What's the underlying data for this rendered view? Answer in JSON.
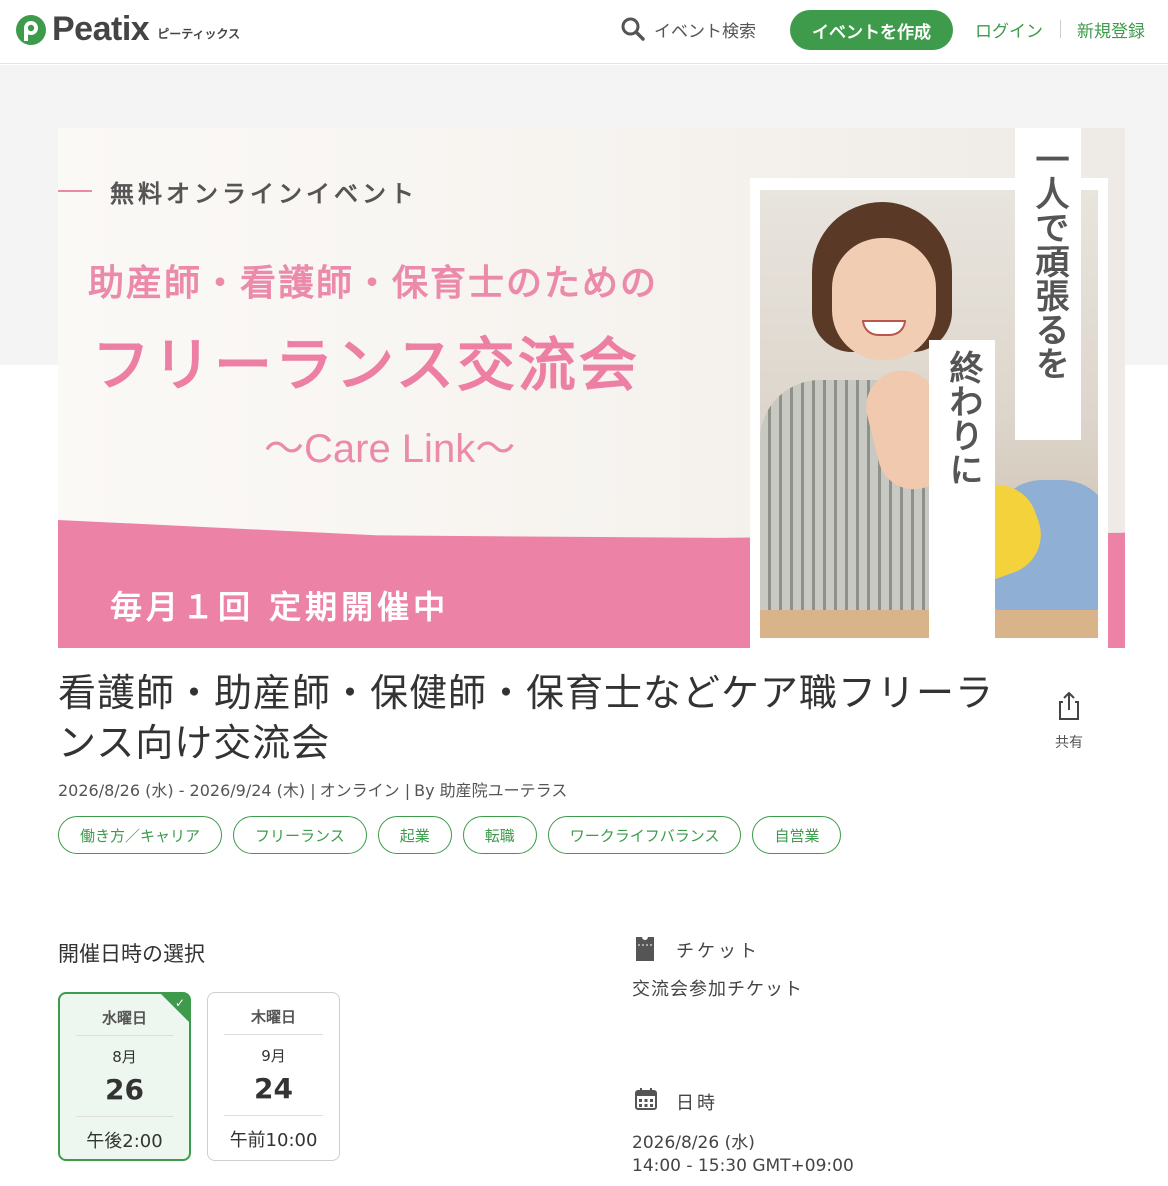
{
  "header": {
    "logo_text": "Peatix",
    "logo_sub": "ピーティックス",
    "search_label": "イベント検索",
    "create_label": "イベントを作成",
    "login_label": "ログイン",
    "signup_label": "新規登録",
    "accent_color": "#3d9b4b"
  },
  "banner": {
    "small_heading": "無料オンラインイベント",
    "subtitle": "助産師・看護師・保育士のための",
    "title": "フリーランス交流会",
    "care_link": "〜Care Link〜",
    "pink_text": "毎月１回 定期開催中",
    "vertical_text_1": "一人で頑張るを",
    "vertical_text_2": "終わりに",
    "pink_color": "#ec82a6"
  },
  "event": {
    "title": "看護師・助産師・保健師・保育士などケア職フリーランス向け交流会",
    "date_range": "2026/8/26 (水) - 2026/9/24 (木) |",
    "location": "オンライン |",
    "organizer": "By 助産院ユーテラス",
    "share_label": "共有",
    "tags": [
      "働き方／キャリア",
      "フリーランス",
      "起業",
      "転職",
      "ワークライフバランス",
      "自営業"
    ]
  },
  "dates": {
    "heading": "開催日時の選択",
    "options": [
      {
        "weekday": "水曜日",
        "month": "8月",
        "day": "26",
        "time": "午後2:00",
        "selected": true
      },
      {
        "weekday": "木曜日",
        "month": "9月",
        "day": "24",
        "time": "午前10:00",
        "selected": false
      }
    ]
  },
  "ticket": {
    "label": "チケット",
    "name": "交流会参加チケット"
  },
  "datetime": {
    "label": "日時",
    "date": "2026/8/26 (水)",
    "time": "14:00 - 15:30 GMT+09:00"
  }
}
